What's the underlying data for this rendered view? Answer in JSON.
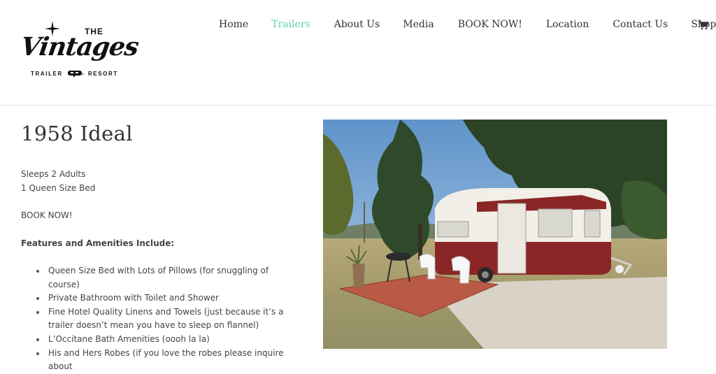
{
  "logo": {
    "the": "THE",
    "script": "Vintages",
    "sub_left": "TRAILER",
    "sub_right": "RESORT"
  },
  "nav": {
    "items": [
      {
        "label": "Home",
        "active": false
      },
      {
        "label": "Trailers",
        "active": true
      },
      {
        "label": "About Us",
        "active": false
      },
      {
        "label": "Media",
        "active": false
      },
      {
        "label": "BOOK NOW!",
        "active": false
      },
      {
        "label": "Location",
        "active": false
      },
      {
        "label": "Contact Us",
        "active": false
      },
      {
        "label": "Shop",
        "active": false
      }
    ],
    "cart_icon": "shopping-cart-icon",
    "active_color": "#5fd3b3"
  },
  "page": {
    "title": "1958 Ideal",
    "sleeps": "Sleeps 2 Adults",
    "bed": "1 Queen Size Bed",
    "book_now": "BOOK NOW!",
    "features_heading": "Features and Amenities Include:",
    "features": [
      "Queen Size Bed with Lots of Pillows (for snuggling of course)",
      "Private Bathroom with Toilet and Shower",
      "Fine Hotel Quality Linens and Towels (just because it’s a trailer doesn’t mean you have to sleep on flannel)",
      "L’Occitane Bath Amenities (oooh la la)",
      "His and Hers Robes (if you love the robes please inquire about"
    ]
  },
  "photo": {
    "subject": "vintage-trailer-photo"
  }
}
